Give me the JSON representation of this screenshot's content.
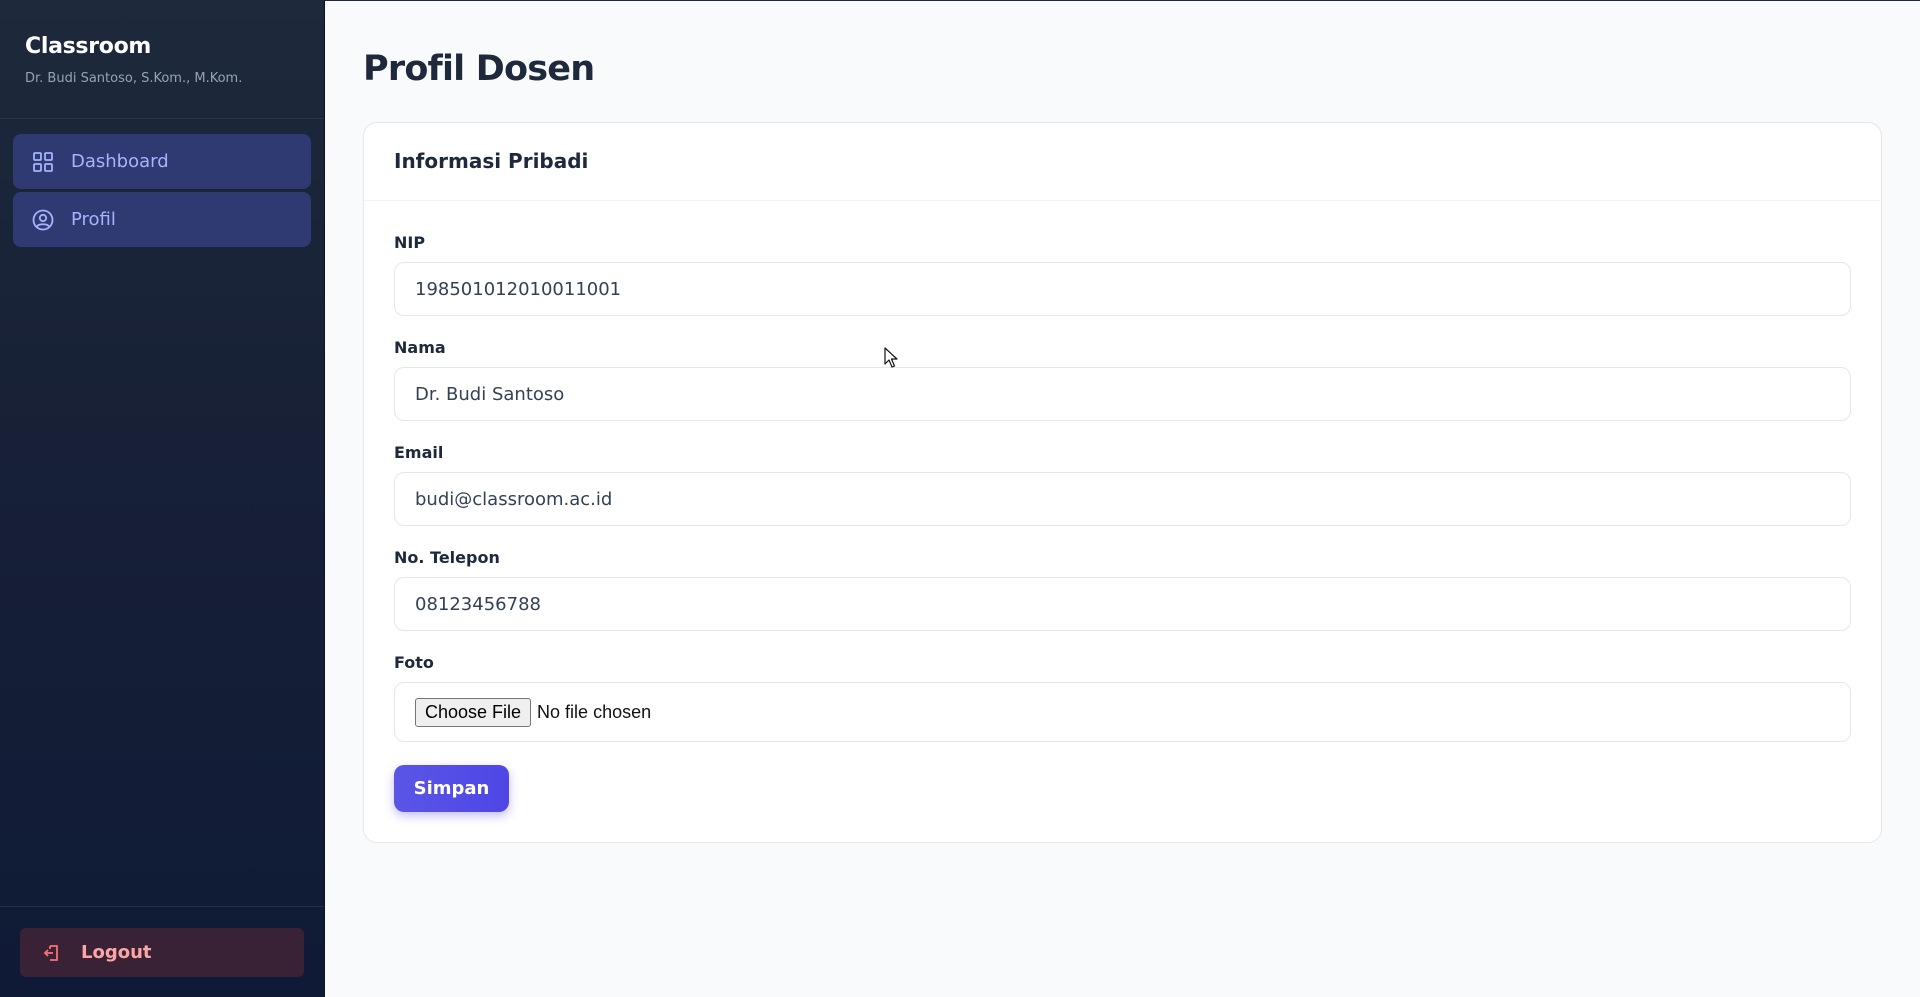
{
  "sidebar": {
    "brand_title": "Classroom",
    "brand_subtitle": "Dr. Budi Santoso, S.Kom., M.Kom.",
    "nav": [
      {
        "label": "Dashboard",
        "icon": "grid-icon"
      },
      {
        "label": "Profil",
        "icon": "user-circle-icon"
      }
    ],
    "logout_label": "Logout"
  },
  "main": {
    "page_title": "Profil Dosen",
    "card_title": "Informasi Pribadi",
    "fields": {
      "nip": {
        "label": "NIP",
        "value": "198501012010011001"
      },
      "nama": {
        "label": "Nama",
        "value": "Dr. Budi Santoso"
      },
      "email": {
        "label": "Email",
        "value": "budi@classroom.ac.id"
      },
      "telepon": {
        "label": "No. Telepon",
        "value": "08123456788"
      },
      "foto": {
        "label": "Foto",
        "button_label": "Choose File",
        "status": "No file chosen"
      }
    },
    "save_label": "Simpan"
  },
  "colors": {
    "accent": "#4f46e5",
    "sidebar_bg": "#1e293b",
    "nav_active_bg": "#303a72",
    "logout_text": "#fca5a5"
  }
}
